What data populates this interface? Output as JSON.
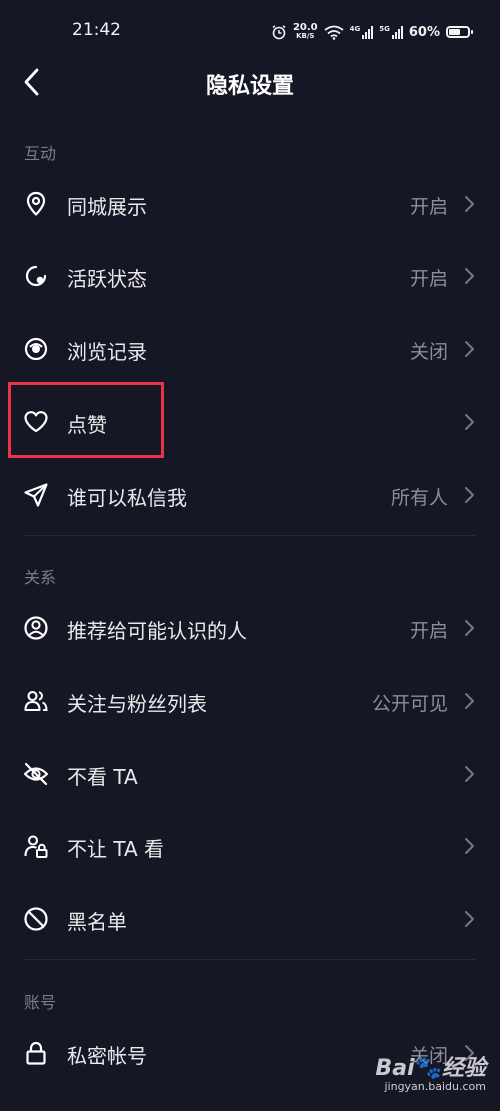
{
  "status_bar": {
    "time": "21:42",
    "speed_value": "20.0",
    "speed_unit": "KB/S",
    "signal1_label": "4G",
    "signal2_label": "5G",
    "battery_text": "60%",
    "battery_level": 0.6
  },
  "nav": {
    "title": "隐私设置"
  },
  "sections": {
    "interaction": "互动",
    "relations": "关系",
    "account": "账号"
  },
  "rows": {
    "city": {
      "label": "同城展示",
      "value": "开启"
    },
    "active": {
      "label": "活跃状态",
      "value": "开启"
    },
    "history": {
      "label": "浏览记录",
      "value": "关闭"
    },
    "likes": {
      "label": "点赞",
      "value": ""
    },
    "dm": {
      "label": "谁可以私信我",
      "value": "所有人"
    },
    "recommend": {
      "label": "推荐给可能认识的人",
      "value": "开启"
    },
    "follow": {
      "label": "关注与粉丝列表",
      "value": "公开可见"
    },
    "hide_ta": {
      "label": "不看 TA",
      "value": ""
    },
    "block_ta": {
      "label": "不让 TA 看",
      "value": ""
    },
    "blacklist": {
      "label": "黑名单",
      "value": ""
    },
    "private": {
      "label": "私密帐号",
      "value": "关闭"
    }
  },
  "watermark": {
    "logo_a": "Bai",
    "logo_b": "经验",
    "url": "jingyan.baidu.com"
  },
  "colors": {
    "background": "#161724",
    "highlight": "#e8334a",
    "secondary_text": "#8c8d96"
  }
}
